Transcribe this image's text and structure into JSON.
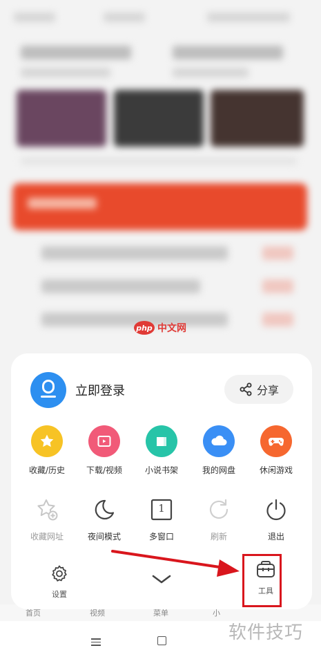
{
  "watermark": {
    "logo": "php",
    "text": "中文网"
  },
  "account": {
    "login_label": "立即登录",
    "avatar_icon": "user-icon",
    "avatar_color": "#2d8ff0"
  },
  "share": {
    "label": "分享",
    "icon": "share-icon"
  },
  "quick_items": [
    {
      "label": "收藏/历史",
      "icon": "star-icon",
      "color": "#f7c325"
    },
    {
      "label": "下载/视频",
      "icon": "video-folder-icon",
      "color": "#f15a78"
    },
    {
      "label": "小说书架",
      "icon": "book-icon",
      "color": "#27c4a8"
    },
    {
      "label": "我的网盘",
      "icon": "cloud-icon",
      "color": "#3a8ff5"
    },
    {
      "label": "休闲游戏",
      "icon": "gamepad-icon",
      "color": "#f6672f"
    }
  ],
  "function_items": [
    {
      "label": "收藏网址",
      "icon": "star-add-icon",
      "enabled": false
    },
    {
      "label": "夜间模式",
      "icon": "moon-icon",
      "enabled": true
    },
    {
      "label": "多窗口",
      "icon": "window-count-icon",
      "enabled": true,
      "badge": "1"
    },
    {
      "label": "刷新",
      "icon": "refresh-icon",
      "enabled": false
    },
    {
      "label": "退出",
      "icon": "power-icon",
      "enabled": true
    }
  ],
  "bottom": {
    "settings_label": "设置",
    "settings_icon": "gear-icon",
    "collapse_icon": "chevron-down-icon",
    "tools_label": "工具",
    "tools_icon": "toolbox-icon"
  },
  "background_tabs": [
    "首页",
    "视频",
    "菜单",
    "小"
  ],
  "corner_watermark": "软件技巧",
  "annotation_color": "#d9161d"
}
